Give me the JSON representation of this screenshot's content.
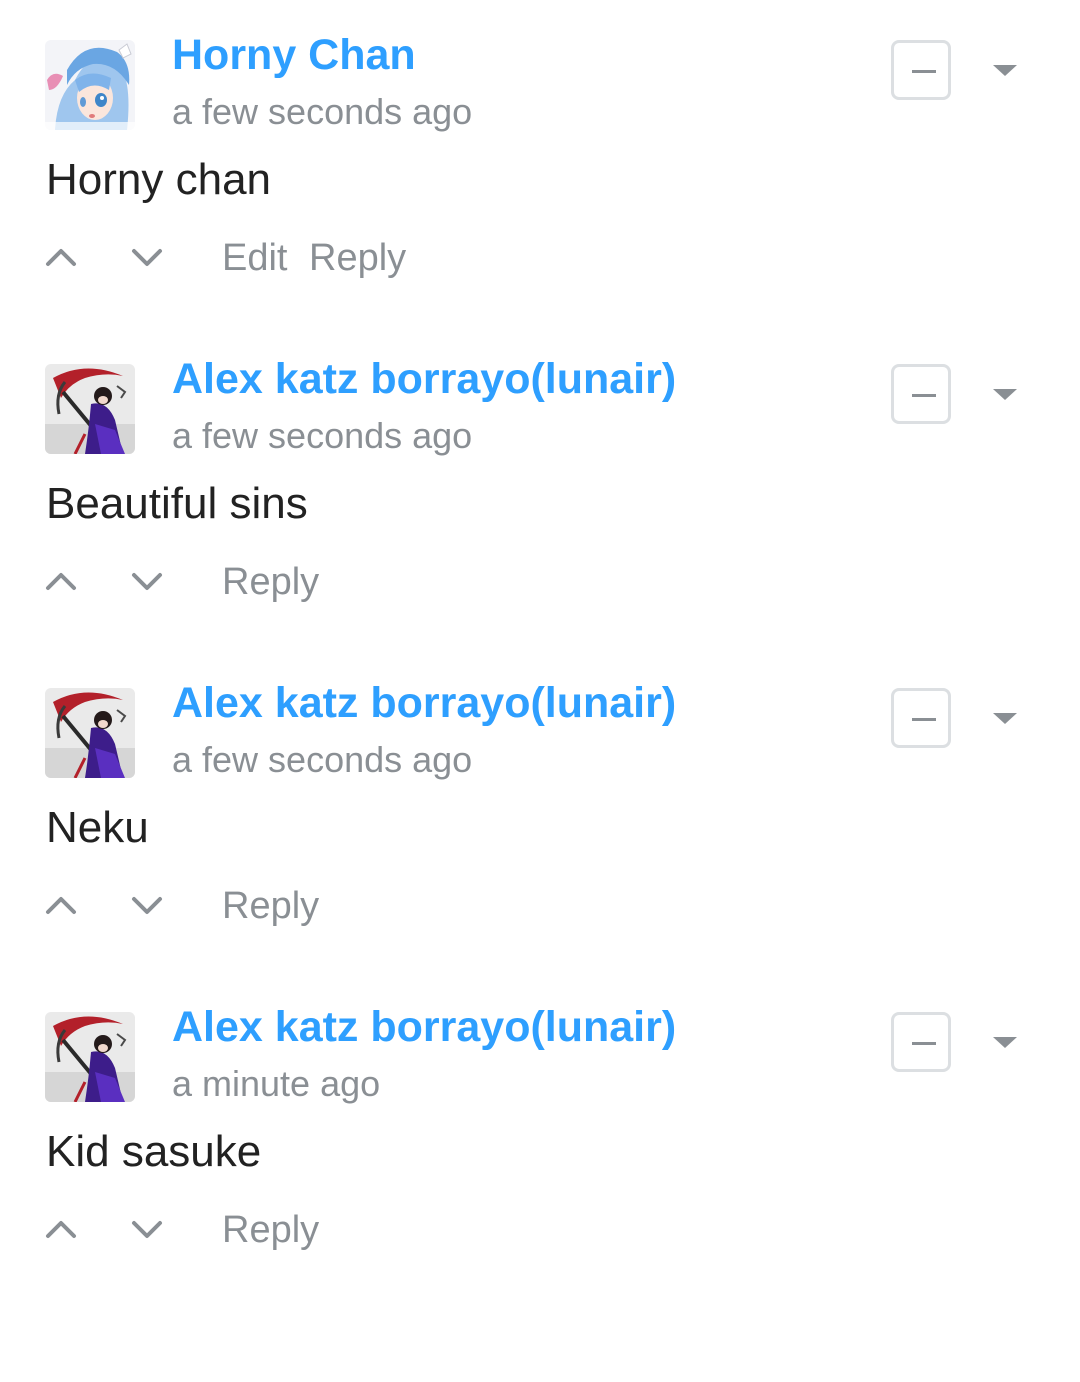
{
  "accent_color": "#2e9fff",
  "comments": [
    {
      "author": "Horny Chan",
      "time": "a few seconds ago",
      "body": "Horny chan",
      "avatar": "anime-girl-blue-hair-avatar",
      "actions": [
        "Edit",
        "Reply"
      ]
    },
    {
      "author": "Alex katz borrayo(lunair)",
      "time": "a few seconds ago",
      "body": "Beautiful sins",
      "avatar": "scythe-character-avatar",
      "actions": [
        "Reply"
      ]
    },
    {
      "author": "Alex katz borrayo(lunair)",
      "time": "a few seconds ago",
      "body": "Neku",
      "avatar": "scythe-character-avatar",
      "actions": [
        "Reply"
      ]
    },
    {
      "author": "Alex katz borrayo(lunair)",
      "time": "a minute ago",
      "body": "Kid sasuke",
      "avatar": "scythe-character-avatar",
      "actions": [
        "Reply"
      ]
    }
  ]
}
